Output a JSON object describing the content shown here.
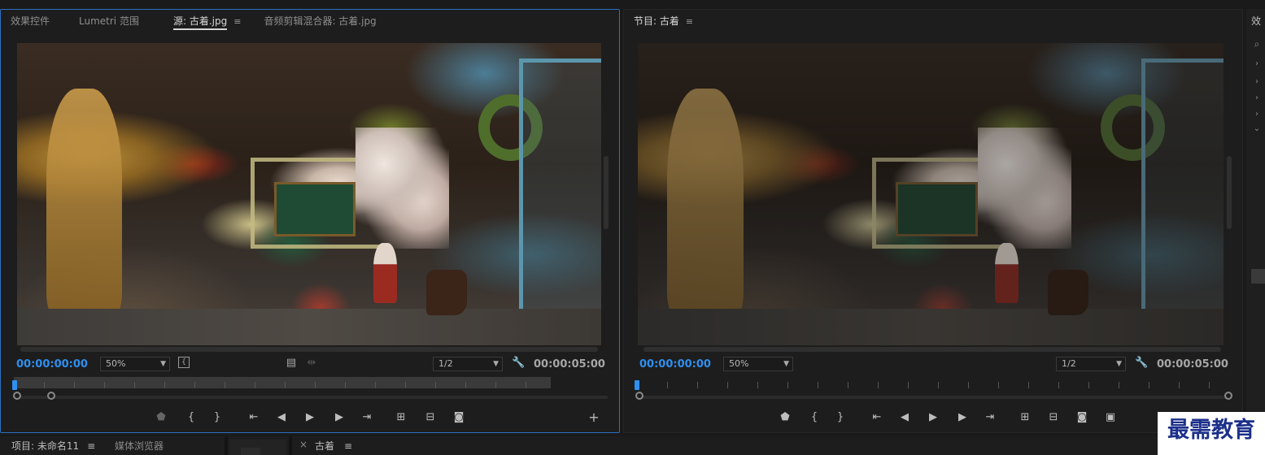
{
  "source_panel": {
    "tabs": [
      {
        "label": "效果控件"
      },
      {
        "label": "Lumetri 范围"
      },
      {
        "label": "源: 古着.jpg",
        "menu": "≡"
      },
      {
        "label": "音频剪辑混合器: 古着.jpg"
      }
    ],
    "active_tab_index": 2,
    "timecode_current": "00:00:00:00",
    "zoom": "50%",
    "resolution": "1/2",
    "timecode_duration": "00:00:05:00",
    "bracket_icon": "{"
  },
  "program_panel": {
    "tab_label": "节目: 古着",
    "menu": "≡",
    "timecode_current": "00:00:00:00",
    "zoom": "50%",
    "resolution": "1/2",
    "timecode_duration": "00:00:05:00"
  },
  "side_panel": {
    "tab_label": "效"
  },
  "bottom_bar": {
    "project_tab": "项目: 未命名11",
    "project_menu": "≡",
    "media_browser_tab": "媒体浏览器",
    "timeline_close": "×",
    "timeline_tab": "古着",
    "timeline_menu": "≡"
  },
  "watermark": "最需教育",
  "icons": {
    "marker": "marker-icon",
    "in_point": "mark-in-icon",
    "out_point": "mark-out-icon",
    "go_to_in": "go-to-in-icon",
    "step_back": "step-back-icon",
    "play": "play-icon",
    "step_forward": "step-forward-icon",
    "go_to_out": "go-to-out-icon",
    "insert": "insert-icon",
    "overwrite": "overwrite-icon",
    "export_frame": "camera-icon",
    "add": "plus-icon",
    "settings": "wrench-icon"
  },
  "colors": {
    "accent_blue": "#2f8ff0",
    "active_border": "#2d6fc0",
    "watermark_text": "#1b2f8a"
  }
}
